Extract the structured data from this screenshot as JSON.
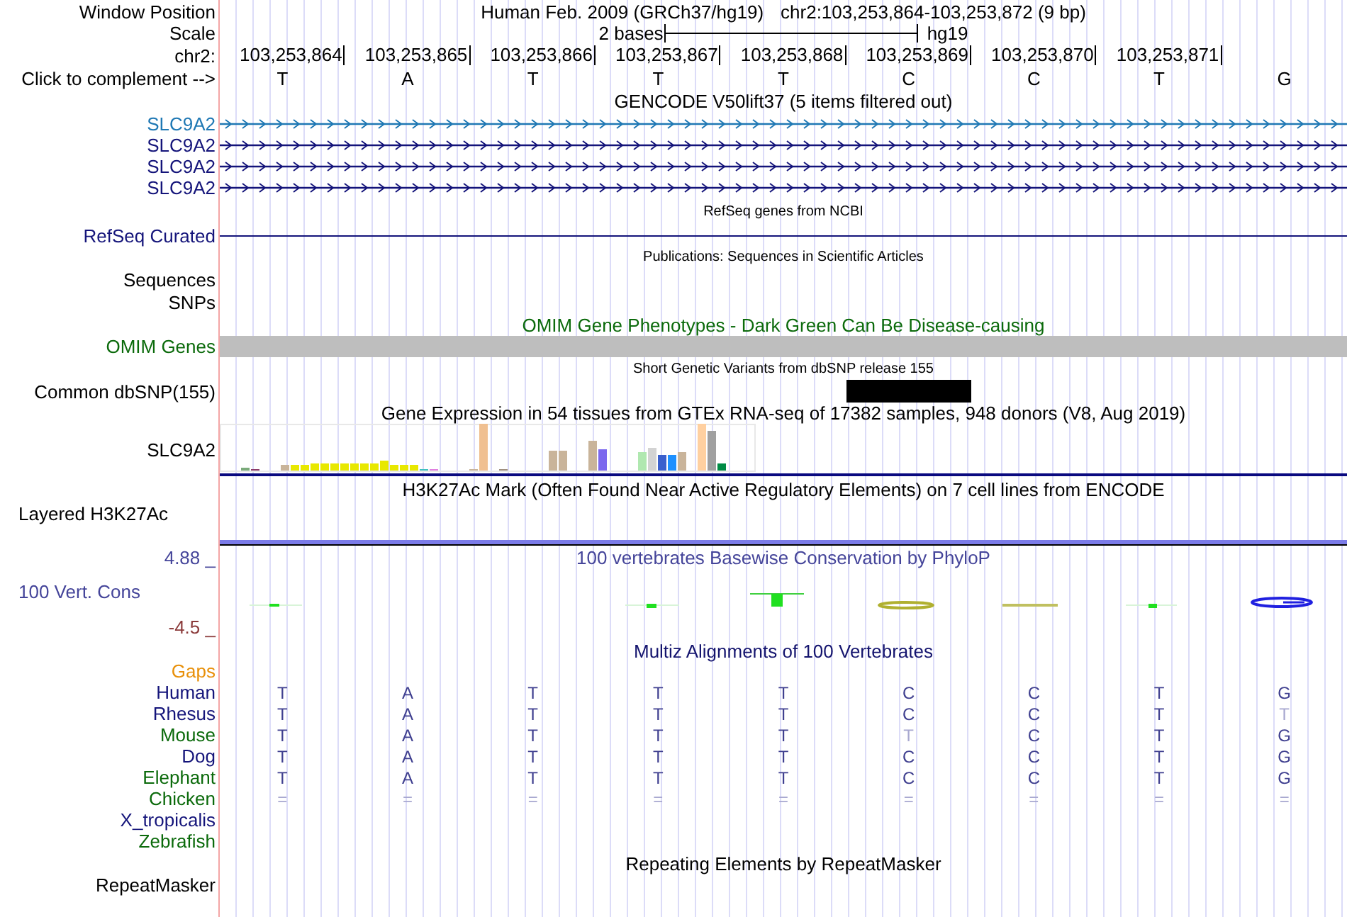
{
  "position": {
    "label": "Window Position",
    "assembly": "Human Feb. 2009 (GRCh37/hg19)",
    "range": "chr2:103,253,864-103,253,872 (9 bp)"
  },
  "scale": {
    "label": "Scale",
    "length": "2 bases",
    "assembly": "hg19"
  },
  "coordinates": {
    "label": "chr2:",
    "ticks": [
      "103,253,864",
      "103,253,865",
      "103,253,866",
      "103,253,867",
      "103,253,868",
      "103,253,869",
      "103,253,870",
      "103,253,871"
    ]
  },
  "sequence": {
    "label": "Click to complement -->",
    "bases": [
      "T",
      "A",
      "T",
      "T",
      "T",
      "C",
      "C",
      "T",
      "G"
    ]
  },
  "tracks": [
    {
      "kind": "genes",
      "title": "GENCODE V50lift37 (5 items filtered out)",
      "color": "#000000",
      "items": [
        {
          "label": "SLC9A2",
          "color": "#1f78b4"
        },
        {
          "label": "SLC9A2",
          "color": "#14147a"
        },
        {
          "label": "SLC9A2",
          "color": "#14147a"
        },
        {
          "label": "SLC9A2",
          "color": "#14147a"
        }
      ]
    },
    {
      "kind": "line",
      "title": "RefSeq genes from NCBI",
      "color": "#000000",
      "label": "RefSeq Curated"
    },
    {
      "kind": "labels",
      "title": "Publications: Sequences in Scientific Articles",
      "color": "#000000",
      "labels": [
        "Sequences",
        "SNPs"
      ]
    },
    {
      "kind": "bar",
      "title": "OMIM Gene Phenotypes - Dark Green Can Be Disease-causing",
      "color": "#0b6a0b",
      "label": "OMIM Genes"
    },
    {
      "kind": "snp",
      "title": "Short Genetic Variants from dbSNP release 155",
      "color": "#000000",
      "label": "Common dbSNP(155)"
    },
    {
      "kind": "expression",
      "title": "Gene Expression in 54 tissues from GTEx RNA-seq of 17382 samples, 948 donors (V8, Aug 2019)",
      "color": "#000000",
      "label": "SLC9A2"
    },
    {
      "kind": "layered",
      "title": "H3K27Ac Mark (Often Found Near Active Regulatory Elements) on 7 cell lines from ENCODE",
      "color": "#000000",
      "label": "Layered H3K27Ac"
    },
    {
      "kind": "conservation",
      "title": "100 vertebrates Basewise Conservation by PhyloP",
      "color": "#45459a",
      "label": "100 Vert. Cons",
      "max_label": "4.88 _",
      "min_label": "-4.5 _"
    },
    {
      "kind": "alignment",
      "title": "Multiz Alignments of 100 Vertebrates",
      "color": "#14146e",
      "gaps_label": "Gaps",
      "species": [
        {
          "name": "Human",
          "color": "#14147a",
          "bases": [
            "T",
            "A",
            "T",
            "T",
            "T",
            "C",
            "C",
            "T",
            "G"
          ]
        },
        {
          "name": "Rhesus",
          "color": "#14147a",
          "bases": [
            "T",
            "A",
            "T",
            "T",
            "T",
            "C",
            "C",
            "T",
            "T"
          ]
        },
        {
          "name": "Mouse",
          "color": "#0b6a0b",
          "bases": [
            "T",
            "A",
            "T",
            "T",
            "T",
            "T",
            "C",
            "T",
            "G"
          ]
        },
        {
          "name": "Dog",
          "color": "#14147a",
          "bases": [
            "T",
            "A",
            "T",
            "T",
            "T",
            "C",
            "C",
            "T",
            "G"
          ]
        },
        {
          "name": "Elephant",
          "color": "#0b6a0b",
          "bases": [
            "T",
            "A",
            "T",
            "T",
            "T",
            "C",
            "C",
            "T",
            "G"
          ]
        },
        {
          "name": "Chicken",
          "color": "#0b6a0b",
          "bases": [
            "=",
            "=",
            "=",
            "=",
            "=",
            "=",
            "=",
            "=",
            "="
          ]
        },
        {
          "name": "X_tropicalis",
          "color": "#14147a"
        },
        {
          "name": "Zebrafish",
          "color": "#0b6a0b"
        }
      ]
    },
    {
      "kind": "repeats",
      "title": "Repeating Elements by RepeatMasker",
      "color": "#000000",
      "label": "RepeatMasker"
    }
  ]
}
